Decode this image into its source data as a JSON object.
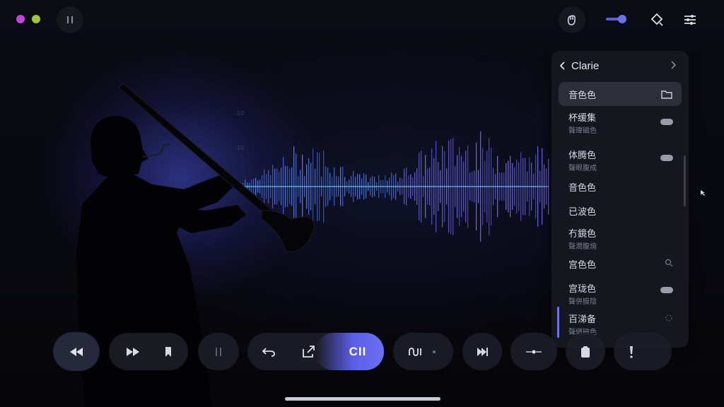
{
  "window": {
    "controls": [
      "pink",
      "lime"
    ]
  },
  "top_bar": {
    "pause_icon": "pause-icon",
    "icons": [
      "hand-icon",
      "slider-toggle",
      "location-search-icon",
      "settings-sliders-icon"
    ]
  },
  "waveform": {
    "tick_labels": [
      "-10",
      "-10"
    ]
  },
  "panel": {
    "title": "Clarie",
    "items": [
      {
        "label": "音色色",
        "sub": "",
        "right": "folder-icon",
        "active": true
      },
      {
        "label": "杯缓集",
        "sub": "聲瑋磁色",
        "right": "toggle"
      },
      {
        "label": "体腾色",
        "sub": "聲眼腹成",
        "right": "toggle"
      },
      {
        "label": "音色色",
        "sub": "",
        "right": ""
      },
      {
        "label": "已波色",
        "sub": "",
        "right": ""
      },
      {
        "label": "冇鏡色",
        "sub": "聲潤腹焼",
        "right": ""
      },
      {
        "label": "宫色色",
        "sub": "",
        "right": "search-icon"
      },
      {
        "label": "宫珑色",
        "sub": "聲併膜陰",
        "right": "toggle"
      },
      {
        "label": "百涕备",
        "sub": "聲縉磁色",
        "right": "spinner-icon"
      }
    ]
  },
  "controls": {
    "accent_label": "CII",
    "buttons": [
      "rewind-icon",
      "fast-forward-icon",
      "bookmark-icon",
      "pause-icon",
      "undo-icon",
      "export-icon",
      "loop-icon",
      "skip-end-icon",
      "split-icon",
      "clipboard-icon",
      "exclamation-icon"
    ]
  },
  "colors": {
    "accent": "#5a5ee6",
    "panel_bg": "#181820",
    "wave_blue": "#4a7be8",
    "wave_violet": "#7a5ee8"
  }
}
